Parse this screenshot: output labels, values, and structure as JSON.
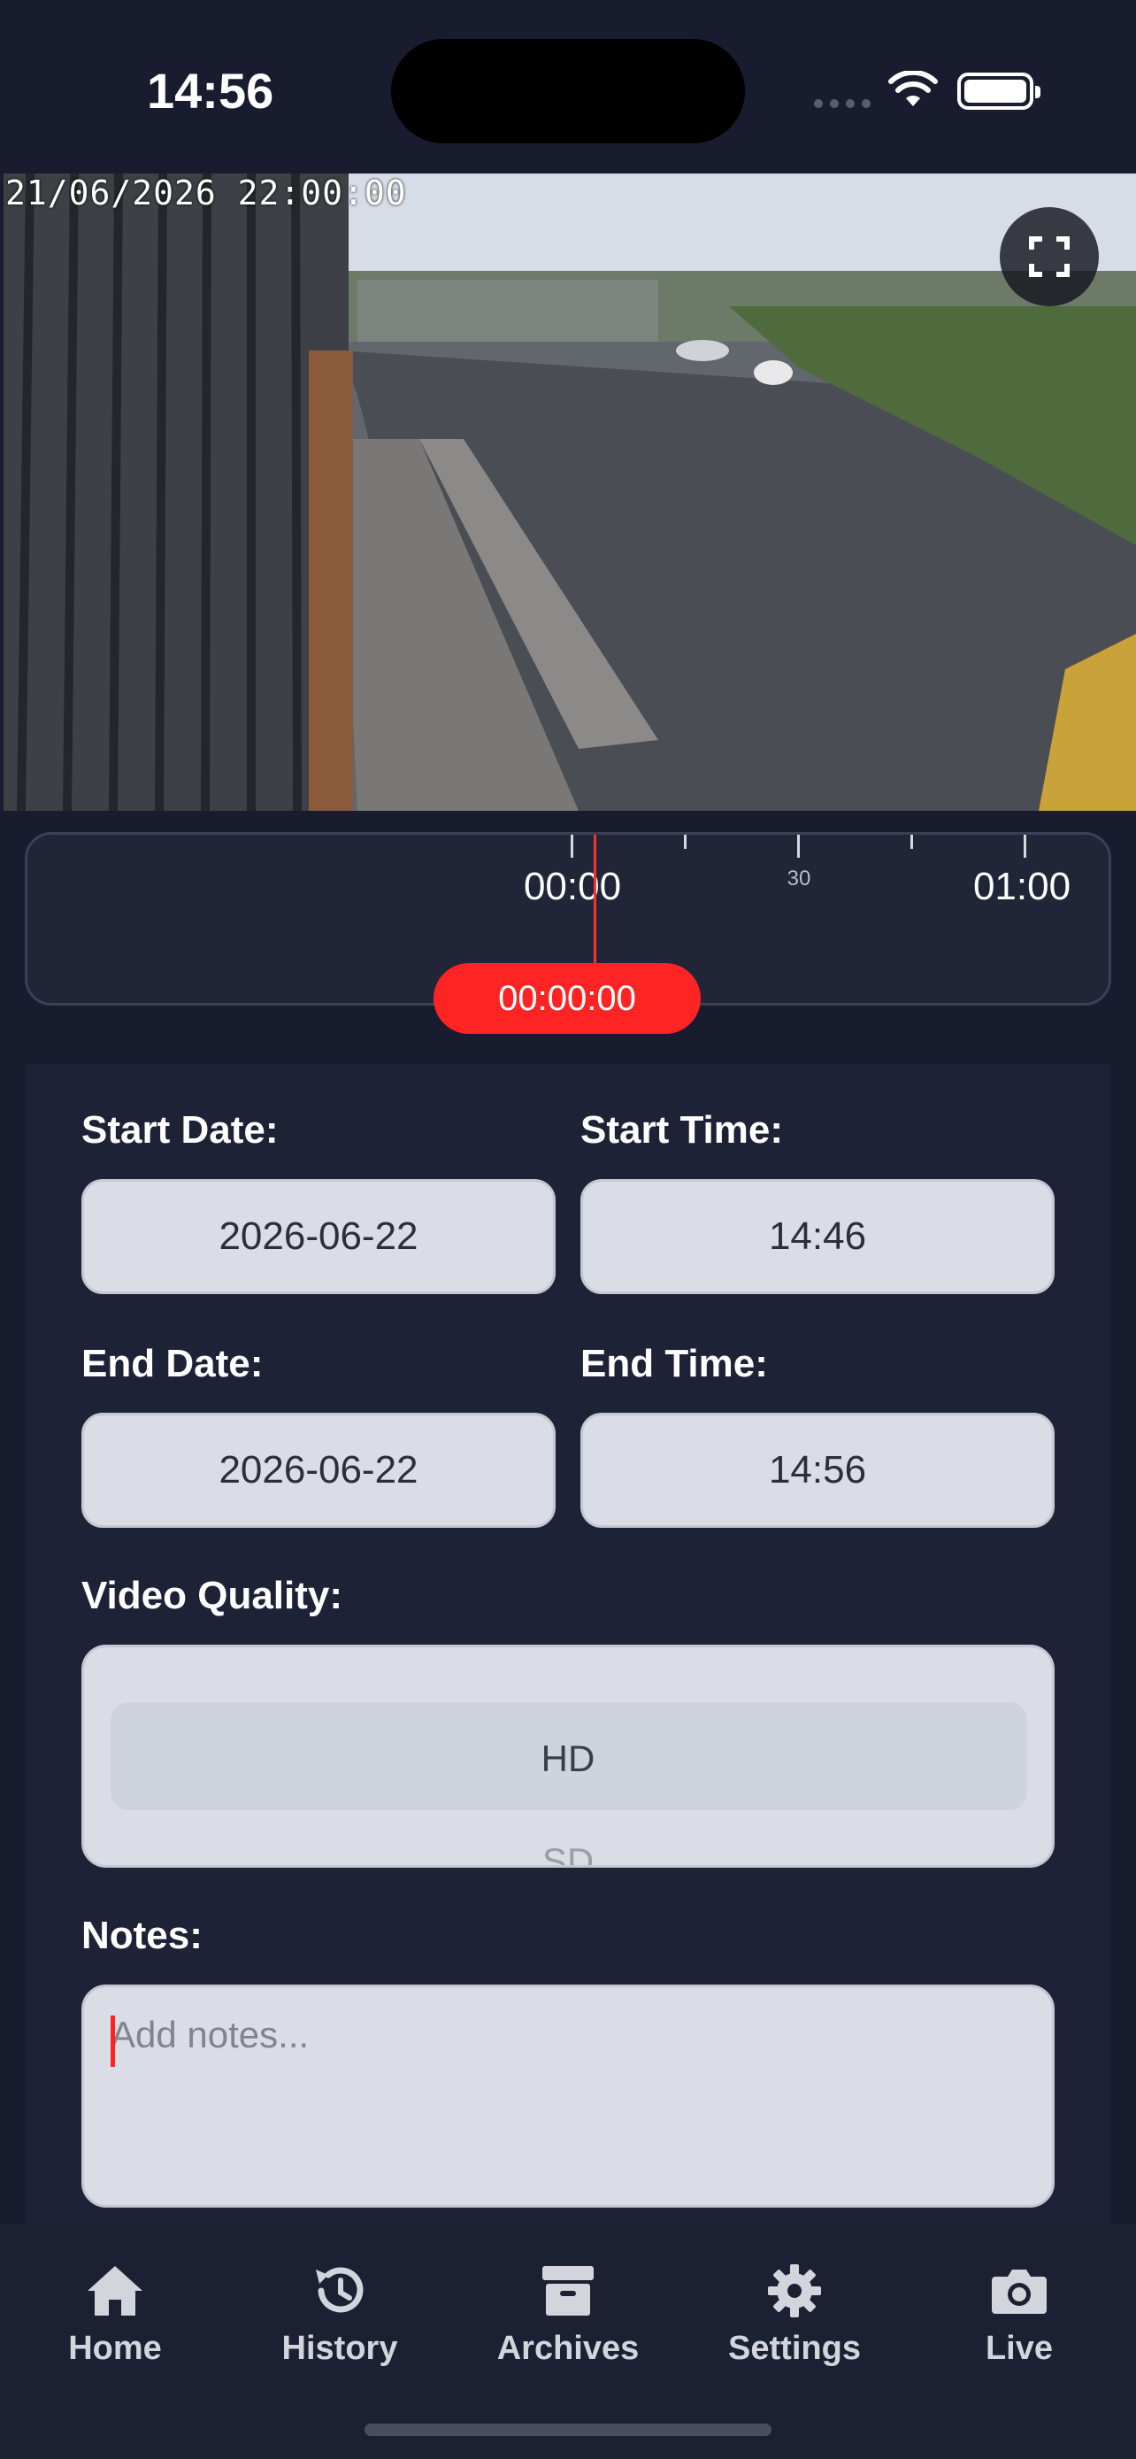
{
  "status_bar": {
    "time": "14:56"
  },
  "video": {
    "timestamp": "21/06/2026 22:00:00"
  },
  "timeline": {
    "ticks": [
      {
        "label": "00:00",
        "size": "large"
      },
      {
        "label": "30",
        "size": "small"
      },
      {
        "label": "01:00",
        "size": "large"
      }
    ],
    "current_time": "00:00:00",
    "playhead_color": "#ff2d2d"
  },
  "form": {
    "start_date_label": "Start Date:",
    "start_date_value": "2026-06-22",
    "start_time_label": "Start Time:",
    "start_time_value": "14:46",
    "end_date_label": "End Date:",
    "end_date_value": "2026-06-22",
    "end_time_label": "End Time:",
    "end_time_value": "14:56",
    "quality_label": "Video Quality:",
    "quality_options": [
      "HD",
      "SD"
    ],
    "quality_selected": "HD",
    "notes_label": "Notes:",
    "notes_placeholder": "Add notes...",
    "notes_value": ""
  },
  "tabs": [
    {
      "label": "Home",
      "icon": "home-icon"
    },
    {
      "label": "History",
      "icon": "history-icon"
    },
    {
      "label": "Archives",
      "icon": "archive-box-icon"
    },
    {
      "label": "Settings",
      "icon": "gear-icon"
    },
    {
      "label": "Live",
      "icon": "camera-icon"
    }
  ],
  "colors": {
    "background": "#181c2e",
    "accent_red": "#ff2424",
    "field_bg": "#dadde6"
  }
}
